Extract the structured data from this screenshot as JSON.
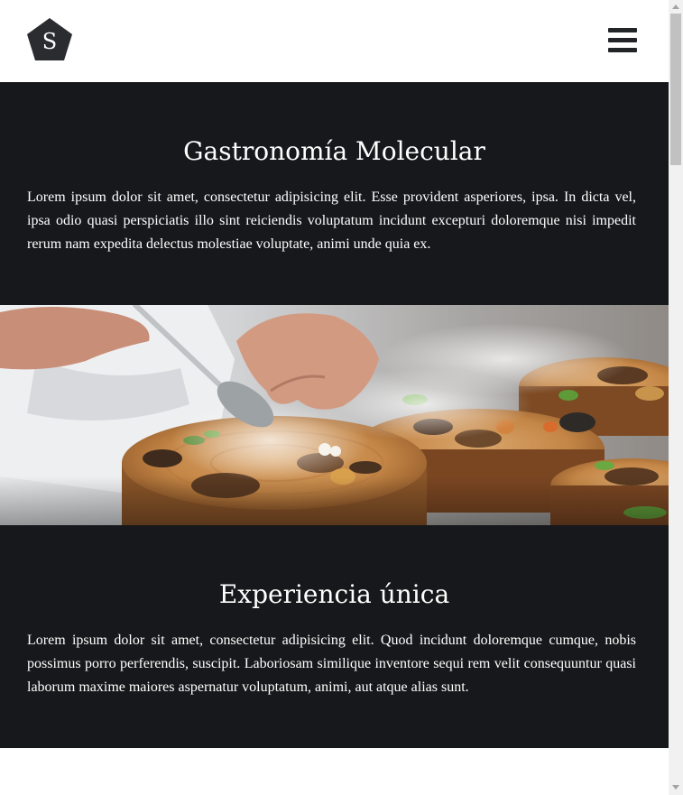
{
  "header": {
    "logo_letter": "S",
    "menu_icon": "hamburger-menu-icon"
  },
  "sections": [
    {
      "title": "Gastronomía Molecular",
      "body": "Lorem ipsum dolor sit amet, consectetur adipisicing elit. Esse provident asperiores, ipsa. In dicta vel, ipsa odio quasi perspiciatis illo sint reiciendis voluptatum incidunt excepturi doloremque nisi impedit rerum nam expedita delectus molestiae voluptate, animi unde quia ex."
    },
    {
      "title": "Experiencia única",
      "body": "Lorem ipsum dolor sit amet, consectetur adipisicing elit. Quod incidunt doloremque cumque, nobis possimus porro perferendis, suscipit. Laboriosam similique inventore sequi rem velit consequuntur quasi laborum maxime maiores aspernatur voluptatum, animi, aut atque alias sunt."
    }
  ],
  "colors": {
    "dark_section": "#17181b",
    "logo_fill": "#2b2c30",
    "menu_bars": "#232427",
    "text_light": "#ffffff"
  }
}
